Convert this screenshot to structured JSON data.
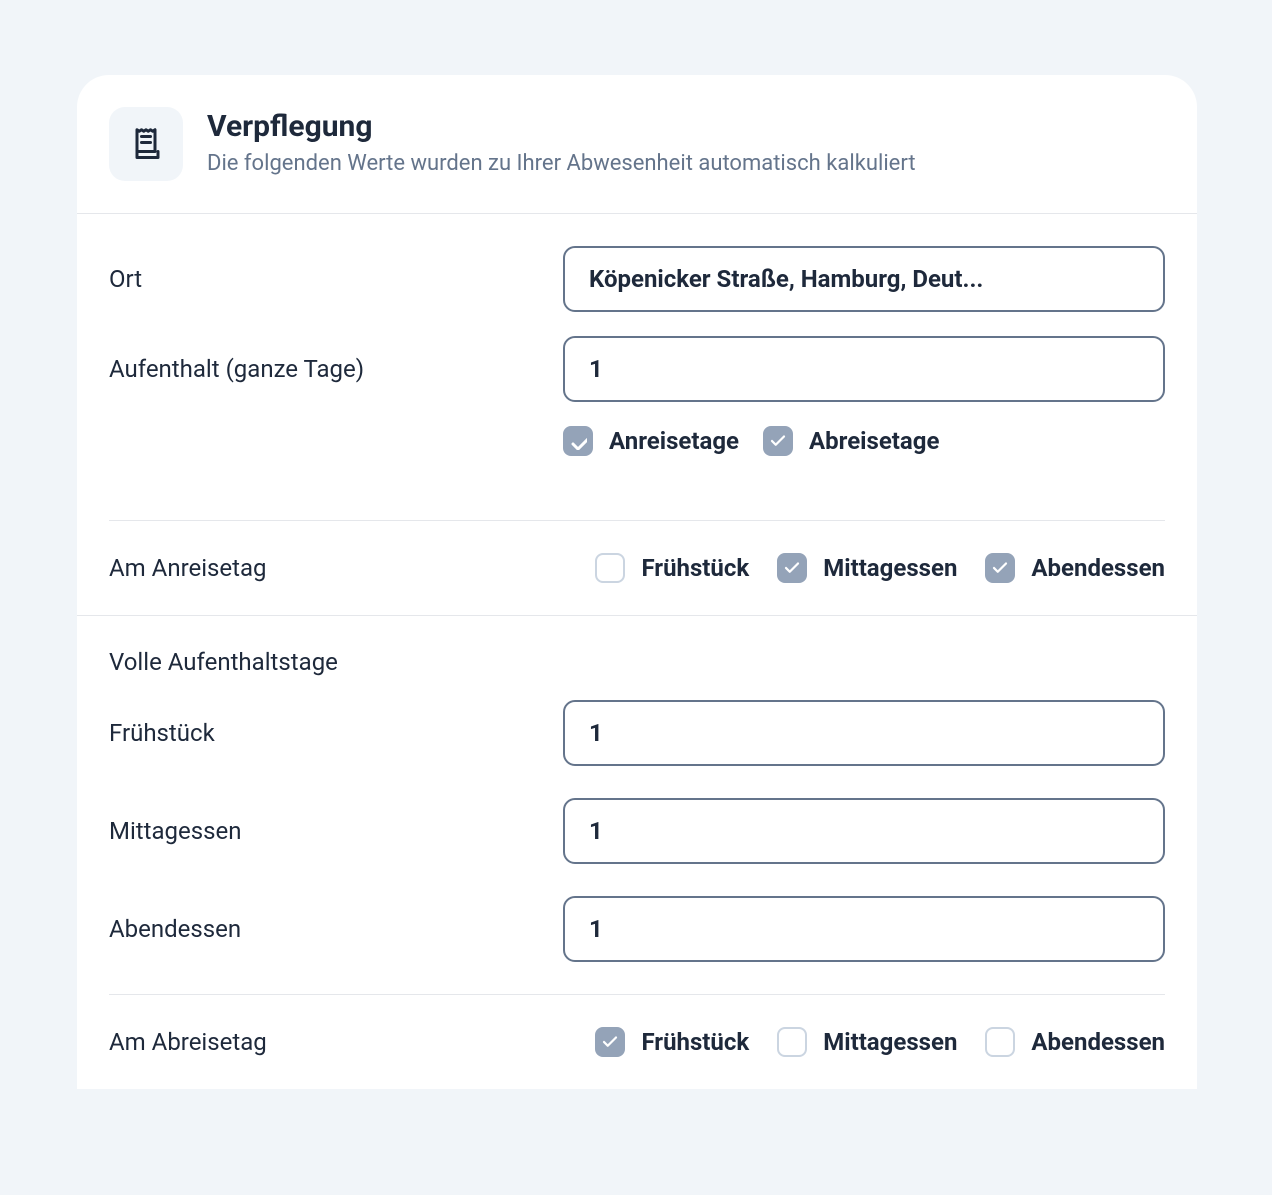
{
  "header": {
    "title": "Verpflegung",
    "subtitle": "Die folgenden Werte wurden zu Ihrer Abwesenheit automatisch kalkuliert"
  },
  "fields": {
    "location": {
      "label": "Ort",
      "value": "Köpenicker Straße, Hamburg, Deut..."
    },
    "duration": {
      "label": "Aufenthalt (ganze Tage)",
      "value": "1"
    },
    "travel_days": {
      "arrival_label": "Anreisetage",
      "arrival_checked": true,
      "departure_label": "Abreisetage",
      "departure_checked": true
    }
  },
  "arrival_day": {
    "label": "Am Anreisetag",
    "meals": {
      "breakfast": {
        "label": "Frühstück",
        "checked": false
      },
      "lunch": {
        "label": "Mittagessen",
        "checked": true
      },
      "dinner": {
        "label": "Abendessen",
        "checked": true
      }
    }
  },
  "full_days": {
    "title": "Volle Aufenthaltstage",
    "breakfast": {
      "label": "Frühstück",
      "value": "1"
    },
    "lunch": {
      "label": "Mittagessen",
      "value": "1"
    },
    "dinner": {
      "label": "Abendessen",
      "value": "1"
    }
  },
  "departure_day": {
    "label": "Am Abreisetag",
    "meals": {
      "breakfast": {
        "label": "Frühstück",
        "checked": true
      },
      "lunch": {
        "label": "Mittagessen",
        "checked": false
      },
      "dinner": {
        "label": "Abendessen",
        "checked": false
      }
    }
  }
}
